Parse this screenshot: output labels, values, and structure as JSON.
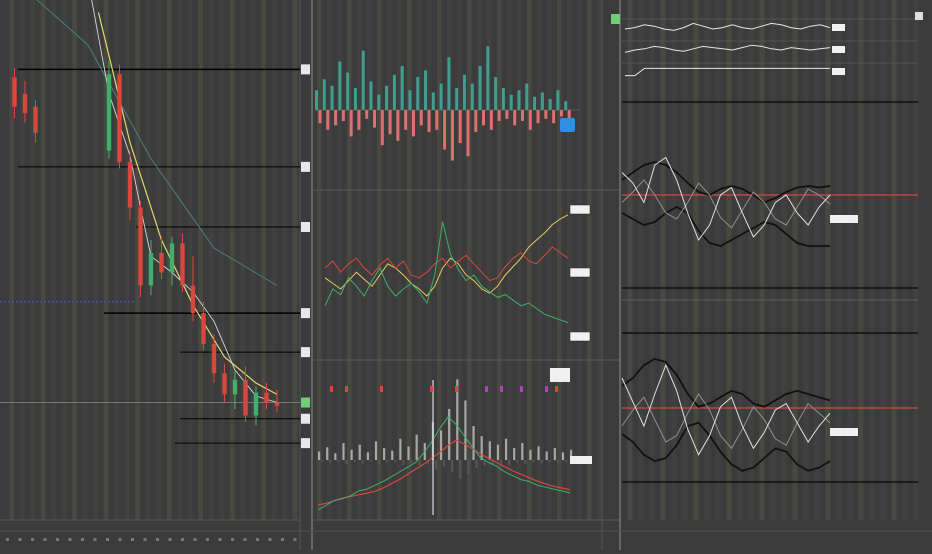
{
  "title": "",
  "chart_data": [
    {
      "type": "candlestick",
      "panel": "price",
      "title": "",
      "ylabel": "",
      "price_levels": [
        1.845,
        1.785,
        1.748,
        1.695,
        1.671,
        1.63,
        1.615
      ],
      "candles": [
        {
          "x": 1,
          "o": 1.84,
          "h": 1.846,
          "l": 1.815,
          "c": 1.822,
          "up": false
        },
        {
          "x": 2,
          "o": 1.83,
          "h": 1.838,
          "l": 1.812,
          "c": 1.818,
          "up": false
        },
        {
          "x": 3,
          "o": 1.822,
          "h": 1.826,
          "l": 1.8,
          "c": 1.806,
          "up": false
        },
        {
          "x": 10,
          "o": 1.795,
          "h": 1.85,
          "l": 1.79,
          "c": 1.842,
          "up": true
        },
        {
          "x": 11,
          "o": 1.842,
          "h": 1.848,
          "l": 1.784,
          "c": 1.788,
          "up": false
        },
        {
          "x": 12,
          "o": 1.788,
          "h": 1.795,
          "l": 1.752,
          "c": 1.76,
          "up": false
        },
        {
          "x": 13,
          "o": 1.76,
          "h": 1.764,
          "l": 1.705,
          "c": 1.712,
          "up": false
        },
        {
          "x": 14,
          "o": 1.712,
          "h": 1.74,
          "l": 1.706,
          "c": 1.732,
          "up": true
        },
        {
          "x": 15,
          "o": 1.732,
          "h": 1.742,
          "l": 1.716,
          "c": 1.72,
          "up": false
        },
        {
          "x": 16,
          "o": 1.72,
          "h": 1.742,
          "l": 1.712,
          "c": 1.738,
          "up": true
        },
        {
          "x": 17,
          "o": 1.738,
          "h": 1.744,
          "l": 1.708,
          "c": 1.712,
          "up": false
        },
        {
          "x": 18,
          "o": 1.712,
          "h": 1.73,
          "l": 1.69,
          "c": 1.695,
          "up": false
        },
        {
          "x": 19,
          "o": 1.695,
          "h": 1.702,
          "l": 1.672,
          "c": 1.676,
          "up": false
        },
        {
          "x": 20,
          "o": 1.676,
          "h": 1.682,
          "l": 1.652,
          "c": 1.658,
          "up": false
        },
        {
          "x": 21,
          "o": 1.658,
          "h": 1.664,
          "l": 1.64,
          "c": 1.645,
          "up": false
        },
        {
          "x": 22,
          "o": 1.645,
          "h": 1.66,
          "l": 1.636,
          "c": 1.654,
          "up": true
        },
        {
          "x": 23,
          "o": 1.654,
          "h": 1.662,
          "l": 1.628,
          "c": 1.632,
          "up": false
        },
        {
          "x": 24,
          "o": 1.632,
          "h": 1.65,
          "l": 1.626,
          "c": 1.646,
          "up": true
        },
        {
          "x": 25,
          "o": 1.646,
          "h": 1.652,
          "l": 1.636,
          "c": 1.64,
          "up": false
        },
        {
          "x": 26,
          "o": 1.64,
          "h": 1.648,
          "l": 1.634,
          "c": 1.638,
          "up": false
        }
      ],
      "ma_fast": [
        [
          8,
          1.9
        ],
        [
          10,
          1.83
        ],
        [
          12,
          1.792
        ],
        [
          13,
          1.76
        ],
        [
          14,
          1.73
        ],
        [
          16,
          1.72
        ],
        [
          18,
          1.708
        ],
        [
          20,
          1.69
        ],
        [
          22,
          1.66
        ],
        [
          24,
          1.644
        ],
        [
          26,
          1.64
        ]
      ],
      "ma_slow": [
        [
          9,
          1.88
        ],
        [
          12,
          1.8
        ],
        [
          15,
          1.74
        ],
        [
          18,
          1.7
        ],
        [
          21,
          1.668
        ],
        [
          24,
          1.652
        ],
        [
          26,
          1.645
        ]
      ],
      "ma_long": [
        [
          1,
          1.9
        ],
        [
          8,
          1.86
        ],
        [
          14,
          1.79
        ],
        [
          20,
          1.735
        ],
        [
          26,
          1.712
        ]
      ],
      "blue_level": 1.702,
      "grey_level": 1.64
    },
    {
      "type": "bar",
      "panel": "histogram",
      "pos": [
        0.9,
        1.4,
        1.1,
        2.2,
        1.7,
        1.0,
        2.7,
        1.3,
        0.7,
        1.1,
        1.6,
        2.0,
        0.9,
        1.5,
        1.8,
        0.8,
        1.2,
        2.4,
        1.0,
        1.6,
        1.2,
        2.0,
        2.9,
        1.5,
        1.0,
        0.7,
        0.9,
        1.2,
        0.6,
        0.8,
        0.5,
        0.9,
        0.4
      ],
      "neg": [
        0.6,
        0.9,
        0.7,
        0.5,
        1.2,
        0.9,
        0.4,
        0.8,
        1.6,
        1.1,
        1.4,
        0.9,
        1.2,
        0.7,
        1.0,
        0.9,
        1.8,
        2.3,
        1.5,
        2.1,
        1.0,
        0.7,
        0.9,
        0.5,
        0.4,
        0.7,
        0.5,
        0.9,
        0.6,
        0.4,
        0.6,
        0.3,
        0.4
      ]
    },
    {
      "type": "line",
      "panel": "oscillator",
      "series": [
        {
          "color": "#e8c85a",
          "values": [
            0.48,
            0.44,
            0.4,
            0.46,
            0.52,
            0.47,
            0.42,
            0.5,
            0.58,
            0.55,
            0.5,
            0.44,
            0.4,
            0.35,
            0.42,
            0.55,
            0.62,
            0.58,
            0.5,
            0.46,
            0.4,
            0.37,
            0.42,
            0.5,
            0.56,
            0.62,
            0.7,
            0.75,
            0.8,
            0.86,
            0.9,
            0.93
          ]
        },
        {
          "color": "#d9473c",
          "values": [
            0.55,
            0.6,
            0.52,
            0.58,
            0.62,
            0.55,
            0.5,
            0.57,
            0.62,
            0.55,
            0.6,
            0.5,
            0.48,
            0.52,
            0.58,
            0.62,
            0.55,
            0.6,
            0.64,
            0.58,
            0.52,
            0.46,
            0.48,
            0.56,
            0.62,
            0.66,
            0.6,
            0.58,
            0.64,
            0.7,
            0.66,
            0.62
          ]
        },
        {
          "color": "#3fb06b",
          "values": [
            0.28,
            0.4,
            0.36,
            0.48,
            0.42,
            0.35,
            0.46,
            0.55,
            0.42,
            0.35,
            0.4,
            0.44,
            0.38,
            0.3,
            0.5,
            0.88,
            0.65,
            0.54,
            0.46,
            0.5,
            0.42,
            0.38,
            0.34,
            0.36,
            0.32,
            0.28,
            0.3,
            0.26,
            0.22,
            0.2,
            0.18,
            0.16
          ]
        }
      ]
    },
    {
      "type": "bar",
      "panel": "volume",
      "values": [
        0.1,
        0.15,
        0.08,
        0.2,
        0.12,
        0.18,
        0.09,
        0.22,
        0.14,
        0.11,
        0.25,
        0.16,
        0.3,
        0.2,
        0.45,
        0.35,
        0.6,
        0.95,
        0.7,
        0.4,
        0.28,
        0.22,
        0.18,
        0.25,
        0.14,
        0.2,
        0.12,
        0.16,
        0.1,
        0.14,
        0.09,
        0.12
      ],
      "ma_red": [
        0.0,
        0.02,
        0.05,
        0.08,
        0.1,
        0.12,
        0.14,
        0.16,
        0.2,
        0.25,
        0.3,
        0.36,
        0.42,
        0.48,
        0.55,
        0.62,
        0.7,
        0.76,
        0.72,
        0.66,
        0.6,
        0.55,
        0.5,
        0.45,
        0.4,
        0.36,
        0.32,
        0.28,
        0.25,
        0.22,
        0.2,
        0.18
      ],
      "ma_green": [
        0.0,
        0.05,
        0.1,
        0.12,
        0.15,
        0.2,
        0.22,
        0.26,
        0.3,
        0.35,
        0.4,
        0.45,
        0.5,
        0.6,
        0.72,
        0.86,
        0.98,
        0.9,
        0.78,
        0.66,
        0.55,
        0.5,
        0.46,
        0.4,
        0.36,
        0.32,
        0.3,
        0.26,
        0.24,
        0.22,
        0.2,
        0.18
      ]
    },
    {
      "type": "line",
      "panel": "sub-oscillators",
      "series": [
        {
          "values": [
            0.5,
            0.6,
            0.8,
            0.7,
            0.5,
            0.4,
            0.6,
            0.9,
            0.7,
            0.5,
            0.6,
            0.8,
            0.6,
            0.5,
            0.7,
            0.9,
            0.8,
            0.6,
            0.5,
            0.7,
            0.8,
            0.6
          ]
        },
        {
          "values": [
            0.3,
            0.5,
            0.6,
            0.8,
            0.7,
            0.5,
            0.4,
            0.6,
            0.8,
            0.7,
            0.6,
            0.5,
            0.7,
            0.9,
            0.8,
            0.6,
            0.5,
            0.7,
            0.6,
            0.5,
            0.6,
            0.7
          ]
        },
        {
          "values": [
            0.2,
            0.2,
            0.8,
            0.8,
            0.8,
            0.8,
            0.8,
            0.8,
            0.8,
            0.8,
            0.8,
            0.8,
            0.8,
            0.8,
            0.8,
            0.8,
            0.8,
            0.8,
            0.8,
            0.8,
            0.8,
            0.8
          ]
        }
      ]
    },
    {
      "type": "line",
      "panel": "bands-upper",
      "center": 0.5,
      "upper": [
        0.4,
        0.35,
        0.3,
        0.28,
        0.3,
        0.35,
        0.42,
        0.48,
        0.5,
        0.46,
        0.44,
        0.46,
        0.5,
        0.55,
        0.52,
        0.48,
        0.45,
        0.44,
        0.45,
        0.44
      ],
      "lower": [
        0.62,
        0.66,
        0.7,
        0.68,
        0.62,
        0.58,
        0.62,
        0.74,
        0.82,
        0.84,
        0.8,
        0.76,
        0.72,
        0.68,
        0.7,
        0.76,
        0.82,
        0.84,
        0.84,
        0.84
      ],
      "osc_white": [
        0.35,
        0.42,
        0.55,
        0.3,
        0.25,
        0.4,
        0.62,
        0.8,
        0.7,
        0.5,
        0.45,
        0.62,
        0.78,
        0.7,
        0.55,
        0.5,
        0.62,
        0.7,
        0.58,
        0.5
      ],
      "osc_grey": [
        0.55,
        0.48,
        0.4,
        0.5,
        0.62,
        0.66,
        0.55,
        0.42,
        0.5,
        0.65,
        0.72,
        0.6,
        0.48,
        0.55,
        0.66,
        0.7,
        0.58,
        0.46,
        0.5,
        0.56
      ]
    },
    {
      "type": "line",
      "panel": "bands-lower",
      "center": 0.5,
      "upper": [
        0.35,
        0.3,
        0.22,
        0.18,
        0.2,
        0.28,
        0.4,
        0.48,
        0.46,
        0.42,
        0.38,
        0.4,
        0.46,
        0.48,
        0.44,
        0.4,
        0.38,
        0.4,
        0.42,
        0.44
      ],
      "lower": [
        0.65,
        0.7,
        0.78,
        0.82,
        0.8,
        0.72,
        0.6,
        0.58,
        0.66,
        0.76,
        0.84,
        0.88,
        0.86,
        0.8,
        0.74,
        0.76,
        0.84,
        0.88,
        0.86,
        0.82
      ],
      "osc_white": [
        0.3,
        0.45,
        0.6,
        0.4,
        0.22,
        0.38,
        0.62,
        0.78,
        0.66,
        0.48,
        0.42,
        0.6,
        0.74,
        0.64,
        0.5,
        0.46,
        0.58,
        0.7,
        0.6,
        0.52
      ],
      "osc_grey": [
        0.6,
        0.5,
        0.42,
        0.56,
        0.7,
        0.66,
        0.52,
        0.4,
        0.5,
        0.66,
        0.74,
        0.62,
        0.48,
        0.56,
        0.68,
        0.72,
        0.58,
        0.46,
        0.52,
        0.58
      ]
    }
  ]
}
